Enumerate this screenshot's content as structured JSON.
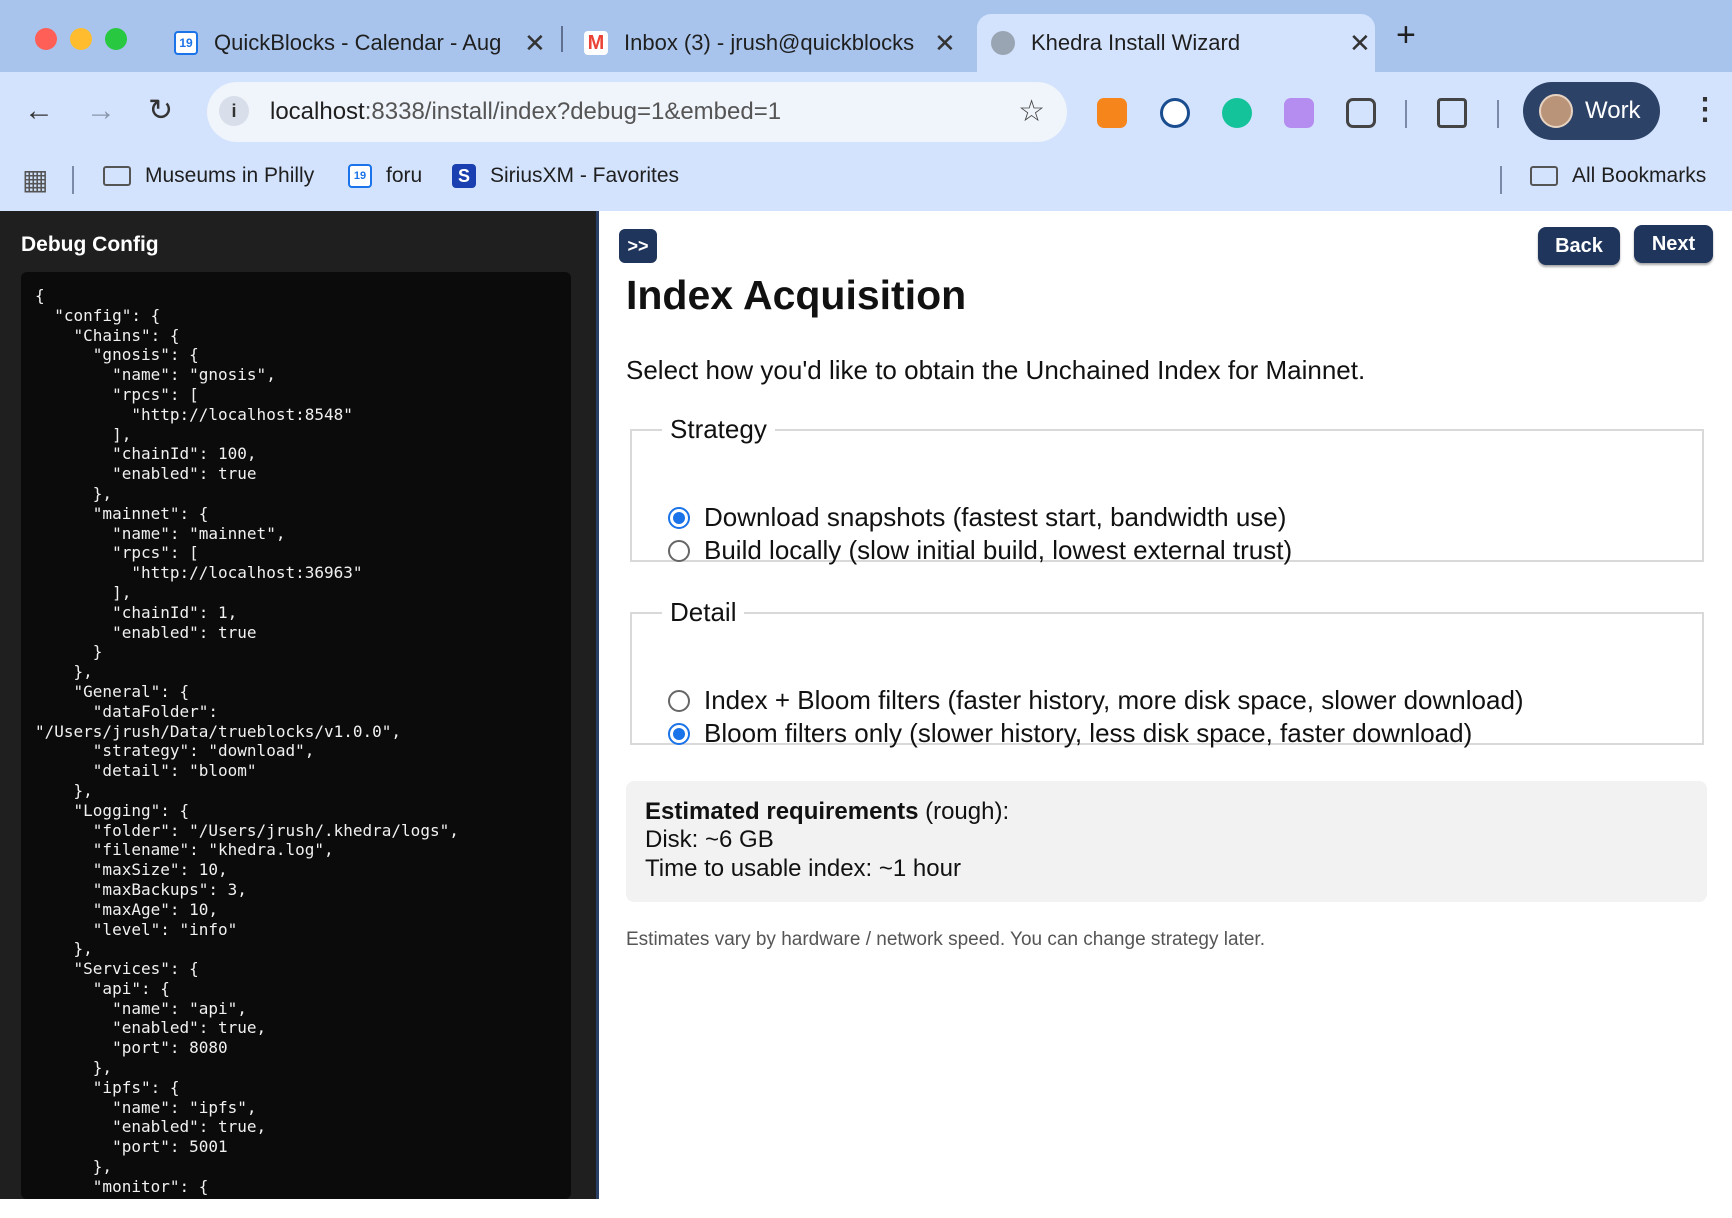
{
  "browser": {
    "tabs": [
      {
        "title": "QuickBlocks - Calendar - Aug",
        "active": false
      },
      {
        "title": "Inbox (3) - jrush@quickblocks",
        "active": false
      },
      {
        "title": "Khedra Install Wizard",
        "active": true
      }
    ],
    "url_host": "localhost",
    "url_rest": ":8338/install/index?debug=1&embed=1",
    "profile_label": "Work",
    "bookmarks": [
      {
        "label": "Museums in Philly",
        "icon": "folder-icon"
      },
      {
        "label": "foru",
        "icon": "calendar-icon"
      },
      {
        "label": "SiriusXM - Favorites",
        "icon": "siriusxm-icon"
      }
    ],
    "all_bookmarks_label": "All Bookmarks"
  },
  "debug": {
    "title": "Debug Config",
    "json_text": "{\n  \"config\": {\n    \"Chains\": {\n      \"gnosis\": {\n        \"name\": \"gnosis\",\n        \"rpcs\": [\n          \"http://localhost:8548\"\n        ],\n        \"chainId\": 100,\n        \"enabled\": true\n      },\n      \"mainnet\": {\n        \"name\": \"mainnet\",\n        \"rpcs\": [\n          \"http://localhost:36963\"\n        ],\n        \"chainId\": 1,\n        \"enabled\": true\n      }\n    },\n    \"General\": {\n      \"dataFolder\":\n\"/Users/jrush/Data/trueblocks/v1.0.0\",\n      \"strategy\": \"download\",\n      \"detail\": \"bloom\"\n    },\n    \"Logging\": {\n      \"folder\": \"/Users/jrush/.khedra/logs\",\n      \"filename\": \"khedra.log\",\n      \"maxSize\": 10,\n      \"maxBackups\": 3,\n      \"maxAge\": 10,\n      \"level\": \"info\"\n    },\n    \"Services\": {\n      \"api\": {\n        \"name\": \"api\",\n        \"enabled\": true,\n        \"port\": 8080\n      },\n      \"ipfs\": {\n        \"name\": \"ipfs\",\n        \"enabled\": true,\n        \"port\": 5001\n      },\n      \"monitor\": {\n        \"name\": \"monitor\","
  },
  "wizard": {
    "collapse_label": ">>",
    "back_label": "Back",
    "next_label": "Next",
    "title": "Index Acquisition",
    "subtitle": "Select how you'd like to obtain the Unchained Index for Mainnet.",
    "strategy": {
      "legend": "Strategy",
      "options": [
        {
          "label": "Download snapshots (fastest start, bandwidth use)",
          "selected": true
        },
        {
          "label": "Build locally (slow initial build, lowest external trust)",
          "selected": false
        }
      ]
    },
    "detail": {
      "legend": "Detail",
      "options": [
        {
          "label": "Index + Bloom filters (faster history, more disk space, slower download)",
          "selected": false
        },
        {
          "label": "Bloom filters only (slower history, less disk space, faster download)",
          "selected": true
        }
      ]
    },
    "estimate": {
      "heading": "Estimated requirements",
      "heading_suffix": " (rough):",
      "disk": "Disk: ~6 GB",
      "time": "Time to usable index: ~1 hour"
    },
    "note": "Estimates vary by hardware / network speed. You can change strategy later."
  },
  "colors": {
    "accent": "#1f355c",
    "radio": "#1a73e8",
    "tabstrip": "#a8c4ec",
    "toolbar": "#d3e3fd"
  }
}
